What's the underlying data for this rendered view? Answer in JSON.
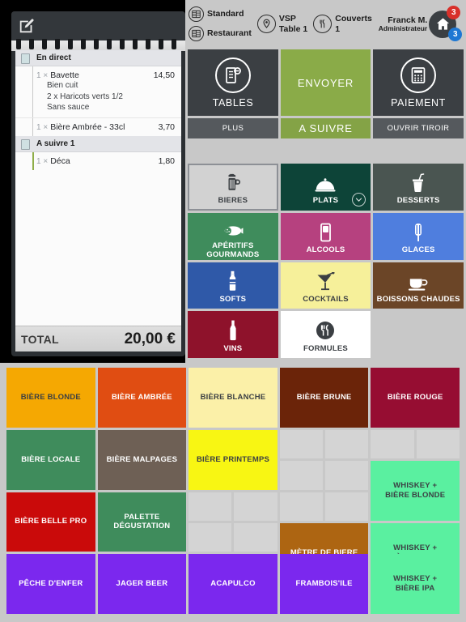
{
  "header": {
    "mode_line1": "Standard",
    "mode_line2": "Restaurant",
    "place_line1": "VSP",
    "place_line2": "Table 1",
    "covers_label": "Couverts",
    "covers_value": "1",
    "user_name": "Franck M.",
    "user_role": "Administrateur",
    "badge_red": "3",
    "badge_blue": "3"
  },
  "receipt": {
    "groups": [
      {
        "title": "En direct",
        "items": [
          {
            "qty": "1",
            "mult": "×",
            "name": "Bavette",
            "price": "14,50",
            "options": [
              "Bien cuit",
              "2 x Haricots verts 1/2",
              "Sans sauce"
            ],
            "accent": false
          },
          {
            "qty": "1",
            "mult": "×",
            "name": "Bière Ambrée - 33cl",
            "price": "3,70",
            "options": [],
            "accent": false
          }
        ]
      },
      {
        "title": "A suivre 1",
        "items": [
          {
            "qty": "1",
            "mult": "×",
            "name": "Déca",
            "price": "1,80",
            "options": [],
            "accent": true
          }
        ]
      }
    ],
    "total_label": "TOTAL",
    "total_value": "20,00 €"
  },
  "actions": {
    "tables_label": "TABLES",
    "plus_label": "PLUS",
    "envoyer_label": "ENVOYER",
    "asuivre_label": "A SUIVRE",
    "paiement_label": "PAIEMENT",
    "tiroir_label": "OUVRIR TIROIR"
  },
  "categories": [
    {
      "label": "BIERES",
      "icon": "beer-mug-icon",
      "bg": "#d2d2d2",
      "fg": "#3b3f43",
      "selected": true,
      "chevron": false
    },
    {
      "label": "PLATS",
      "icon": "cloche-icon",
      "bg": "#0d4438",
      "fg": "#ffffff",
      "selected": false,
      "chevron": true
    },
    {
      "label": "DESSERTS",
      "icon": "dessert-cup-icon",
      "bg": "#4a5551",
      "fg": "#ffffff",
      "selected": false,
      "chevron": false
    },
    {
      "label": "APÉRITIFS GOURMANDS",
      "icon": "sausage-icon",
      "bg": "#3f8c5c",
      "fg": "#ffffff",
      "selected": false,
      "chevron": false
    },
    {
      "label": "ALCOOLS",
      "icon": "glass-icon",
      "bg": "#b6417f",
      "fg": "#ffffff",
      "selected": false,
      "chevron": false
    },
    {
      "label": "GLACES",
      "icon": "ice-cream-icon",
      "bg": "#4f7ede",
      "fg": "#ffffff",
      "selected": false,
      "chevron": false
    },
    {
      "label": "SOFTS",
      "icon": "bottle-icon",
      "bg": "#2f59a8",
      "fg": "#ffffff",
      "selected": false,
      "chevron": false
    },
    {
      "label": "COCKTAILS",
      "icon": "cocktail-icon",
      "bg": "#f6f09a",
      "fg": "#3b3f43",
      "selected": false,
      "chevron": false
    },
    {
      "label": "BOISSONS CHAUDES",
      "icon": "coffee-cup-icon",
      "bg": "#6b4527",
      "fg": "#ffffff",
      "selected": false,
      "chevron": false
    },
    {
      "label": "VINS",
      "icon": "wine-bottle-icon",
      "bg": "#8e122b",
      "fg": "#ffffff",
      "selected": false,
      "chevron": false
    },
    {
      "label": "FORMULES",
      "icon": "cutlery-icon",
      "bg": "#ffffff",
      "fg": "#3b3f43",
      "selected": false,
      "chevron": false
    },
    {
      "label": "",
      "icon": "",
      "bg": "#c8c8c8",
      "fg": "#c8c8c8",
      "selected": false,
      "chevron": false
    }
  ],
  "products": [
    {
      "label": "BIÈRE BLONDE",
      "bg": "#f5a802",
      "fg": "#3b3f43",
      "col": 1,
      "row": 1,
      "empty": false
    },
    {
      "label": "BIÈRE AMBRÉE",
      "bg": "#e04d12",
      "fg": "#ffffff",
      "col": 3,
      "row": 1,
      "empty": false
    },
    {
      "label": "BIÈRE BLANCHE",
      "bg": "#fbf0a8",
      "fg": "#3b3f43",
      "col": 5,
      "row": 1,
      "empty": false
    },
    {
      "label": "BIÈRE BRUNE",
      "bg": "#6b2409",
      "fg": "#ffffff",
      "col": 7,
      "row": 1,
      "empty": false
    },
    {
      "label": "BIÈRE ROUGE",
      "bg": "#960d32",
      "fg": "#ffffff",
      "col": 9,
      "row": 1,
      "empty": false
    },
    {
      "label": "BIÈRE LOCALE",
      "bg": "#3f8c5c",
      "fg": "#ffffff",
      "col": 1,
      "row": 3,
      "empty": false
    },
    {
      "label": "BIÈRE MALPAGES",
      "bg": "#6e6055",
      "fg": "#ffffff",
      "col": 3,
      "row": 3,
      "empty": false
    },
    {
      "label": "BIÈRE PRINTEMPS",
      "bg": "#f8f613",
      "fg": "#3b3f43",
      "col": 5,
      "row": 3,
      "empty": false
    },
    {
      "label": "WHISKEY +\nBIÈRE BLONDE",
      "bg": "#5af0a0",
      "fg": "#3b3f43",
      "col": 9,
      "row": 4,
      "empty": false
    },
    {
      "label": "BIÈRE BELLE PRO",
      "bg": "#ca0a0a",
      "fg": "#ffffff",
      "col": 1,
      "row": 5,
      "empty": false
    },
    {
      "label": "PALETTE\nDÉGUSTATION",
      "bg": "#3f8c5c",
      "fg": "#ffffff",
      "col": 3,
      "row": 5,
      "empty": false
    },
    {
      "label": "MÈTRE DE BIERE",
      "bg": "#ad6512",
      "fg": "#ffffff",
      "col": 7,
      "row": 6,
      "empty": false
    },
    {
      "label": "WHISKEY +\nBIÈRE BRUNE",
      "bg": "#5af0a0",
      "fg": "#3b3f43",
      "col": 9,
      "row": 6,
      "empty": false
    },
    {
      "label": "PÊCHE D'ENFER",
      "bg": "#7b28ee",
      "fg": "#ffffff",
      "col": 1,
      "row": 7,
      "empty": false
    },
    {
      "label": "JAGER BEER",
      "bg": "#7b28ee",
      "fg": "#ffffff",
      "col": 3,
      "row": 7,
      "empty": false
    },
    {
      "label": "ACAPULCO",
      "bg": "#7b28ee",
      "fg": "#ffffff",
      "col": 5,
      "row": 7,
      "empty": false
    },
    {
      "label": "FRAMBOIS'ILE",
      "bg": "#7b28ee",
      "fg": "#ffffff",
      "col": 7,
      "row": 7,
      "empty": false
    },
    {
      "label": "WHISKEY +\nBIÈRE IPA",
      "bg": "#5af0a0",
      "fg": "#3b3f43",
      "col": 9,
      "row": 7,
      "empty": false
    }
  ],
  "empty_cells": [
    {
      "col": 7,
      "row": 3
    },
    {
      "col": 8,
      "row": 3
    },
    {
      "col": 9,
      "row": 3
    },
    {
      "col": 10,
      "row": 3
    },
    {
      "col": 7,
      "row": 4
    },
    {
      "col": 8,
      "row": 4
    },
    {
      "col": 7,
      "row": 5
    },
    {
      "col": 8,
      "row": 5
    },
    {
      "col": 5,
      "row": 5
    },
    {
      "col": 6,
      "row": 5
    },
    {
      "col": 5,
      "row": 6
    },
    {
      "col": 6,
      "row": 6
    }
  ]
}
